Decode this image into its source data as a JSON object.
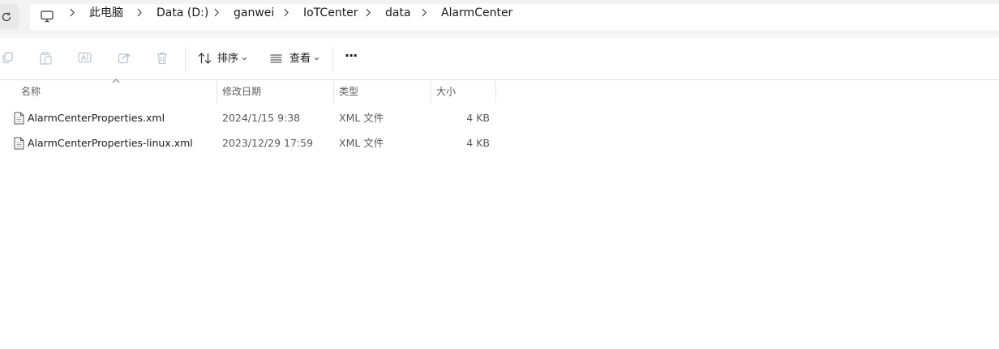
{
  "breadcrumb": [
    "此电脑",
    "Data (D:)",
    "ganwei",
    "IoTCenter",
    "data",
    "AlarmCenter"
  ],
  "toolbar": {
    "sort_label": "排序",
    "view_label": "查看",
    "more_label": "···"
  },
  "columns": {
    "name": "名称",
    "date": "修改日期",
    "type": "类型",
    "size": "大小"
  },
  "files": [
    {
      "name": "AlarmCenterProperties.xml",
      "date": "2024/1/15 9:38",
      "type": "XML 文件",
      "size": "4 KB"
    },
    {
      "name": "AlarmCenterProperties-linux.xml",
      "date": "2023/12/29 17:59",
      "type": "XML 文件",
      "size": "4 KB"
    }
  ],
  "colors": {
    "chrome_background": "#f3f3f3",
    "disabled_icon": "#b8c3cf",
    "text": "#1a1a1a"
  }
}
